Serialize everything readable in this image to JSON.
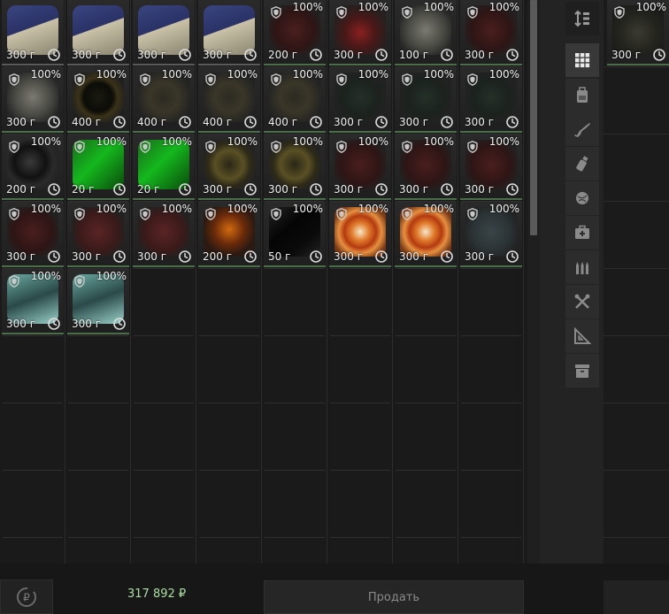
{
  "inventory": {
    "items": [
      {
        "pct": "",
        "weight": "300 г",
        "art": "book",
        "shield": false
      },
      {
        "pct": "",
        "weight": "300 г",
        "art": "book",
        "shield": false
      },
      {
        "pct": "",
        "weight": "300 г",
        "art": "book",
        "shield": false
      },
      {
        "pct": "",
        "weight": "300 г",
        "art": "book",
        "shield": false
      },
      {
        "pct": "100%",
        "weight": "200 г",
        "art": "dark-red",
        "shield": true
      },
      {
        "pct": "100%",
        "weight": "300 г",
        "art": "red-core",
        "shield": true
      },
      {
        "pct": "100%",
        "weight": "100 г",
        "art": "grey-rock",
        "shield": true
      },
      {
        "pct": "100%",
        "weight": "300 г",
        "art": "dark-red",
        "shield": true
      },
      {
        "pct": "100%",
        "weight": "300 г",
        "art": "grey-rock",
        "shield": true
      },
      {
        "pct": "100%",
        "weight": "400 г",
        "art": "spiky-gold",
        "shield": true
      },
      {
        "pct": "100%",
        "weight": "400 г",
        "art": "spiky",
        "shield": true
      },
      {
        "pct": "100%",
        "weight": "400 г",
        "art": "spiky",
        "shield": true
      },
      {
        "pct": "100%",
        "weight": "400 г",
        "art": "spiky",
        "shield": true
      },
      {
        "pct": "100%",
        "weight": "300 г",
        "art": "dark-green",
        "shield": true
      },
      {
        "pct": "100%",
        "weight": "300 г",
        "art": "dark-green",
        "shield": true
      },
      {
        "pct": "100%",
        "weight": "300 г",
        "art": "dark-green",
        "shield": true
      },
      {
        "pct": "100%",
        "weight": "200 г",
        "art": "dark-swirl",
        "shield": true
      },
      {
        "pct": "100%",
        "weight": "20 г",
        "art": "green-crystal",
        "shield": true
      },
      {
        "pct": "100%",
        "weight": "20 г",
        "art": "green-crystal",
        "shield": true
      },
      {
        "pct": "100%",
        "weight": "300 г",
        "art": "olive-ring",
        "shield": true
      },
      {
        "pct": "100%",
        "weight": "300 г",
        "art": "olive-ring",
        "shield": true
      },
      {
        "pct": "100%",
        "weight": "300 г",
        "art": "dark-red",
        "shield": true
      },
      {
        "pct": "100%",
        "weight": "300 г",
        "art": "dark-red",
        "shield": true
      },
      {
        "pct": "100%",
        "weight": "300 г",
        "art": "dark-red",
        "shield": true
      },
      {
        "pct": "100%",
        "weight": "300 г",
        "art": "dark-red",
        "shield": true
      },
      {
        "pct": "100%",
        "weight": "300 г",
        "art": "red-rock",
        "shield": true
      },
      {
        "pct": "100%",
        "weight": "300 г",
        "art": "red-rock",
        "shield": true
      },
      {
        "pct": "100%",
        "weight": "200 г",
        "art": "fire",
        "shield": true
      },
      {
        "pct": "100%",
        "weight": "50 г",
        "art": "black-shard",
        "shield": true
      },
      {
        "pct": "100%",
        "weight": "300 г",
        "art": "orange-swirl",
        "shield": true
      },
      {
        "pct": "100%",
        "weight": "300 г",
        "art": "orange-swirl",
        "shield": true
      },
      {
        "pct": "100%",
        "weight": "300 г",
        "art": "slate",
        "shield": true
      },
      {
        "pct": "100%",
        "weight": "300 г",
        "art": "ice",
        "shield": true
      },
      {
        "pct": "100%",
        "weight": "300 г",
        "art": "ice",
        "shield": true
      }
    ]
  },
  "side_slot": {
    "pct": "100%",
    "weight": "300 г",
    "art": "rock-dark",
    "shield": true
  },
  "categories": [
    {
      "icon": "sort-icon",
      "active": false
    },
    {
      "icon": "grid-all-icon",
      "active": true
    },
    {
      "icon": "backpack-icon",
      "active": false
    },
    {
      "icon": "rifle-icon",
      "active": false
    },
    {
      "icon": "grenade-icon",
      "active": false
    },
    {
      "icon": "artifact-icon",
      "active": false
    },
    {
      "icon": "medkit-icon",
      "active": false
    },
    {
      "icon": "ammo-icon",
      "active": false
    },
    {
      "icon": "tools-icon",
      "active": false
    },
    {
      "icon": "blueprint-icon",
      "active": false
    },
    {
      "icon": "archive-icon",
      "active": false
    }
  ],
  "footer": {
    "sum": "317 892 ₽",
    "sell_label": "Продать",
    "currency_icon": "ruble-cycle-icon"
  },
  "colors": {
    "accent_green": "#4a6d4a",
    "sum_green": "#a8e0a0"
  }
}
